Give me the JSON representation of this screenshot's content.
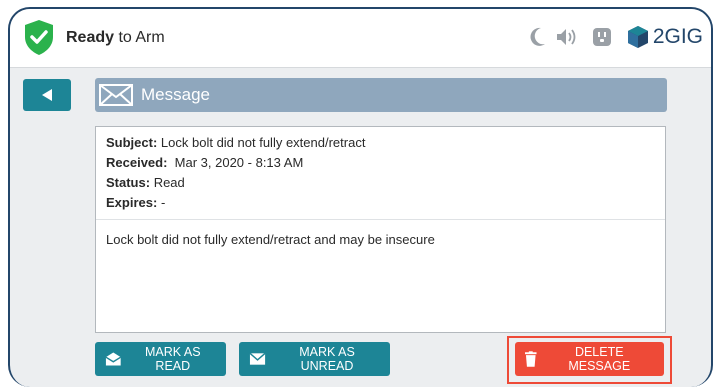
{
  "header": {
    "status_bold": "Ready",
    "status_rest": " to Arm",
    "status_icon": "shield-check-icon",
    "icons": [
      "moon-icon",
      "speaker-icon",
      "outlet-icon"
    ],
    "brand": "2GIG"
  },
  "nav": {
    "back_icon": "back-arrow-icon"
  },
  "message": {
    "header_title": "Message",
    "header_icon": "envelope-icon",
    "subject_label": "Subject:",
    "subject_value": "Lock bolt did not fully extend/retract",
    "received_label": "Received:",
    "received_value": "Mar 3, 2020 - 8:13 AM",
    "status_label": "Status:",
    "status_value": "Read",
    "expires_label": "Expires:",
    "expires_value": "-",
    "body": "Lock bolt did not fully extend/retract and may be insecure"
  },
  "actions": {
    "mark_read": "MARK AS READ",
    "mark_unread": "MARK AS UNREAD",
    "delete": "DELETE MESSAGE"
  },
  "colors": {
    "accent": "#1d8596",
    "danger": "#ee4a37",
    "status_ok": "#2bb24c",
    "header_bar": "#8fa7bd"
  }
}
